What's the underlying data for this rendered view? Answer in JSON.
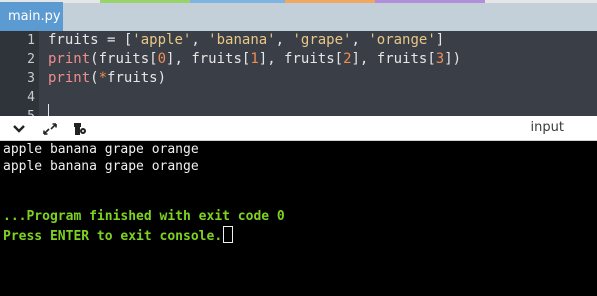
{
  "tab": {
    "label": "main.py"
  },
  "editor": {
    "line_numbers": [
      "1",
      "2",
      "3",
      "4",
      "5"
    ],
    "lines": [
      {
        "tokens": [
          {
            "t": "fruits = [",
            "c": "k-plain"
          },
          {
            "t": "'apple'",
            "c": "k-str"
          },
          {
            "t": ", ",
            "c": "k-plain"
          },
          {
            "t": "'banana'",
            "c": "k-str"
          },
          {
            "t": ", ",
            "c": "k-plain"
          },
          {
            "t": "'grape'",
            "c": "k-str"
          },
          {
            "t": ", ",
            "c": "k-plain"
          },
          {
            "t": "'orange'",
            "c": "k-str"
          },
          {
            "t": "]",
            "c": "k-plain"
          }
        ]
      },
      {
        "tokens": [
          {
            "t": "print",
            "c": "k-fn"
          },
          {
            "t": "(fruits[",
            "c": "k-plain"
          },
          {
            "t": "0",
            "c": "k-num"
          },
          {
            "t": "], fruits[",
            "c": "k-plain"
          },
          {
            "t": "1",
            "c": "k-num"
          },
          {
            "t": "], fruits[",
            "c": "k-plain"
          },
          {
            "t": "2",
            "c": "k-num"
          },
          {
            "t": "], fruits[",
            "c": "k-plain"
          },
          {
            "t": "3",
            "c": "k-num"
          },
          {
            "t": "])",
            "c": "k-plain"
          }
        ]
      },
      {
        "tokens": [
          {
            "t": "print",
            "c": "k-fn"
          },
          {
            "t": "(",
            "c": "k-plain"
          },
          {
            "t": "*",
            "c": "k-op"
          },
          {
            "t": "fruits)",
            "c": "k-plain"
          }
        ]
      }
    ]
  },
  "toolbar": {
    "icons": [
      "chevron-down-icon",
      "expand-icon",
      "settings-icon"
    ],
    "input_label": "input"
  },
  "console": {
    "output_lines": [
      "apple banana grape orange",
      "apple banana grape orange"
    ],
    "finish_message": "...Program finished with exit code 0",
    "prompt_message": "Press ENTER to exit console."
  },
  "colors": {
    "tab_active": "#5c9ad2",
    "editor_bg": "#3a3f47",
    "console_success": "#7ed321"
  }
}
